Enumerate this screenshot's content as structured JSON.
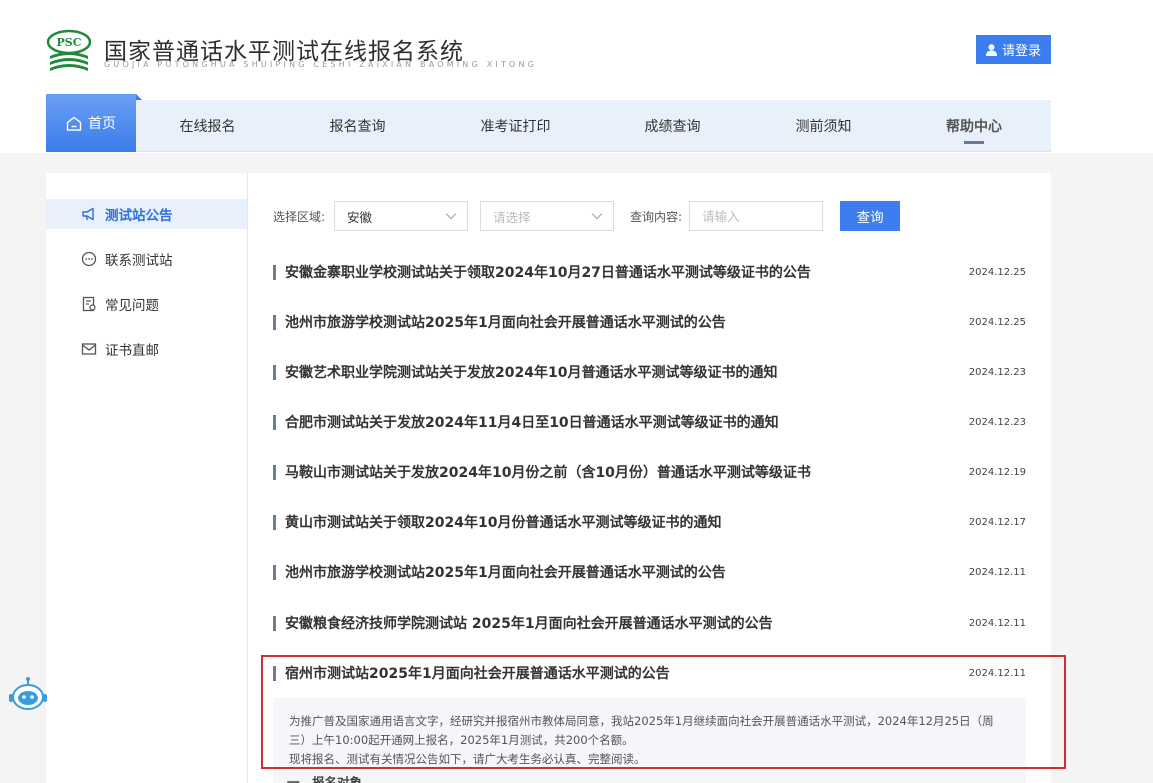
{
  "header": {
    "logo_text": "PSC",
    "title": "国家普通话水平测试在线报名系统",
    "subtitle": "GUOJIA PUTONGHUA SHUIPING CESHI ZAIXIAN BAOMING XITONG",
    "login_label": "请登录"
  },
  "nav": {
    "items": [
      {
        "label": "首页"
      },
      {
        "label": "在线报名"
      },
      {
        "label": "报名查询"
      },
      {
        "label": "准考证打印"
      },
      {
        "label": "成绩查询"
      },
      {
        "label": "测前须知"
      },
      {
        "label": "帮助中心"
      }
    ]
  },
  "sidebar": {
    "items": [
      {
        "label": "测试站公告",
        "icon": "megaphone-icon"
      },
      {
        "label": "联系测试站",
        "icon": "chat-icon"
      },
      {
        "label": "常见问题",
        "icon": "document-icon"
      },
      {
        "label": "证书直邮",
        "icon": "mail-icon"
      }
    ]
  },
  "filters": {
    "region_label": "选择区域:",
    "region_value": "安徽",
    "city_placeholder": "请选择",
    "query_label": "查询内容:",
    "query_placeholder": "请输入",
    "query_button": "查询"
  },
  "notices": [
    {
      "title": "安徽金寨职业学校测试站关于领取2024年10月27日普通话水平测试等级证书的公告",
      "date": "2024.12.25"
    },
    {
      "title": "池州市旅游学校测试站2025年1月面向社会开展普通话水平测试的公告",
      "date": "2024.12.25"
    },
    {
      "title": "安徽艺术职业学院测试站关于发放2024年10月普通话水平测试等级证书的通知",
      "date": "2024.12.23"
    },
    {
      "title": "合肥市测试站关于发放2024年11月4日至10日普通话水平测试等级证书的通知",
      "date": "2024.12.23"
    },
    {
      "title": "马鞍山市测试站关于发放2024年10月份之前（含10月份）普通话水平测试等级证书",
      "date": "2024.12.19"
    },
    {
      "title": "黄山市测试站关于领取2024年10月份普通话水平测试等级证书的通知",
      "date": "2024.12.17"
    },
    {
      "title": "池州市旅游学校测试站2025年1月面向社会开展普通话水平测试的公告",
      "date": "2024.12.11"
    },
    {
      "title": "安徽粮食经济技师学院测试站 2025年1月面向社会开展普通话水平测试的公告",
      "date": "2024.12.11"
    },
    {
      "title": "宿州市测试站2025年1月面向社会开展普通话水平测试的公告",
      "date": "2024.12.11"
    }
  ],
  "detail": {
    "line1": "为推广普及国家通用语言文字，经研究并报宿州市教体局同意，我站2025年1月继续面向社会开展普通话水平测试，2024年12月25日（周",
    "line2": "三）上午10:00起开通网上报名，2025年1月测试，共200个名额。",
    "line3": "现将报名、测试有关情况公告如下，请广大考生务必认真、完整阅读。",
    "heading": "一、报名对象"
  },
  "colors": {
    "accent": "#3c7ef0",
    "highlight_border": "#d12f2f",
    "nav_bg": "#e8f0fb"
  }
}
